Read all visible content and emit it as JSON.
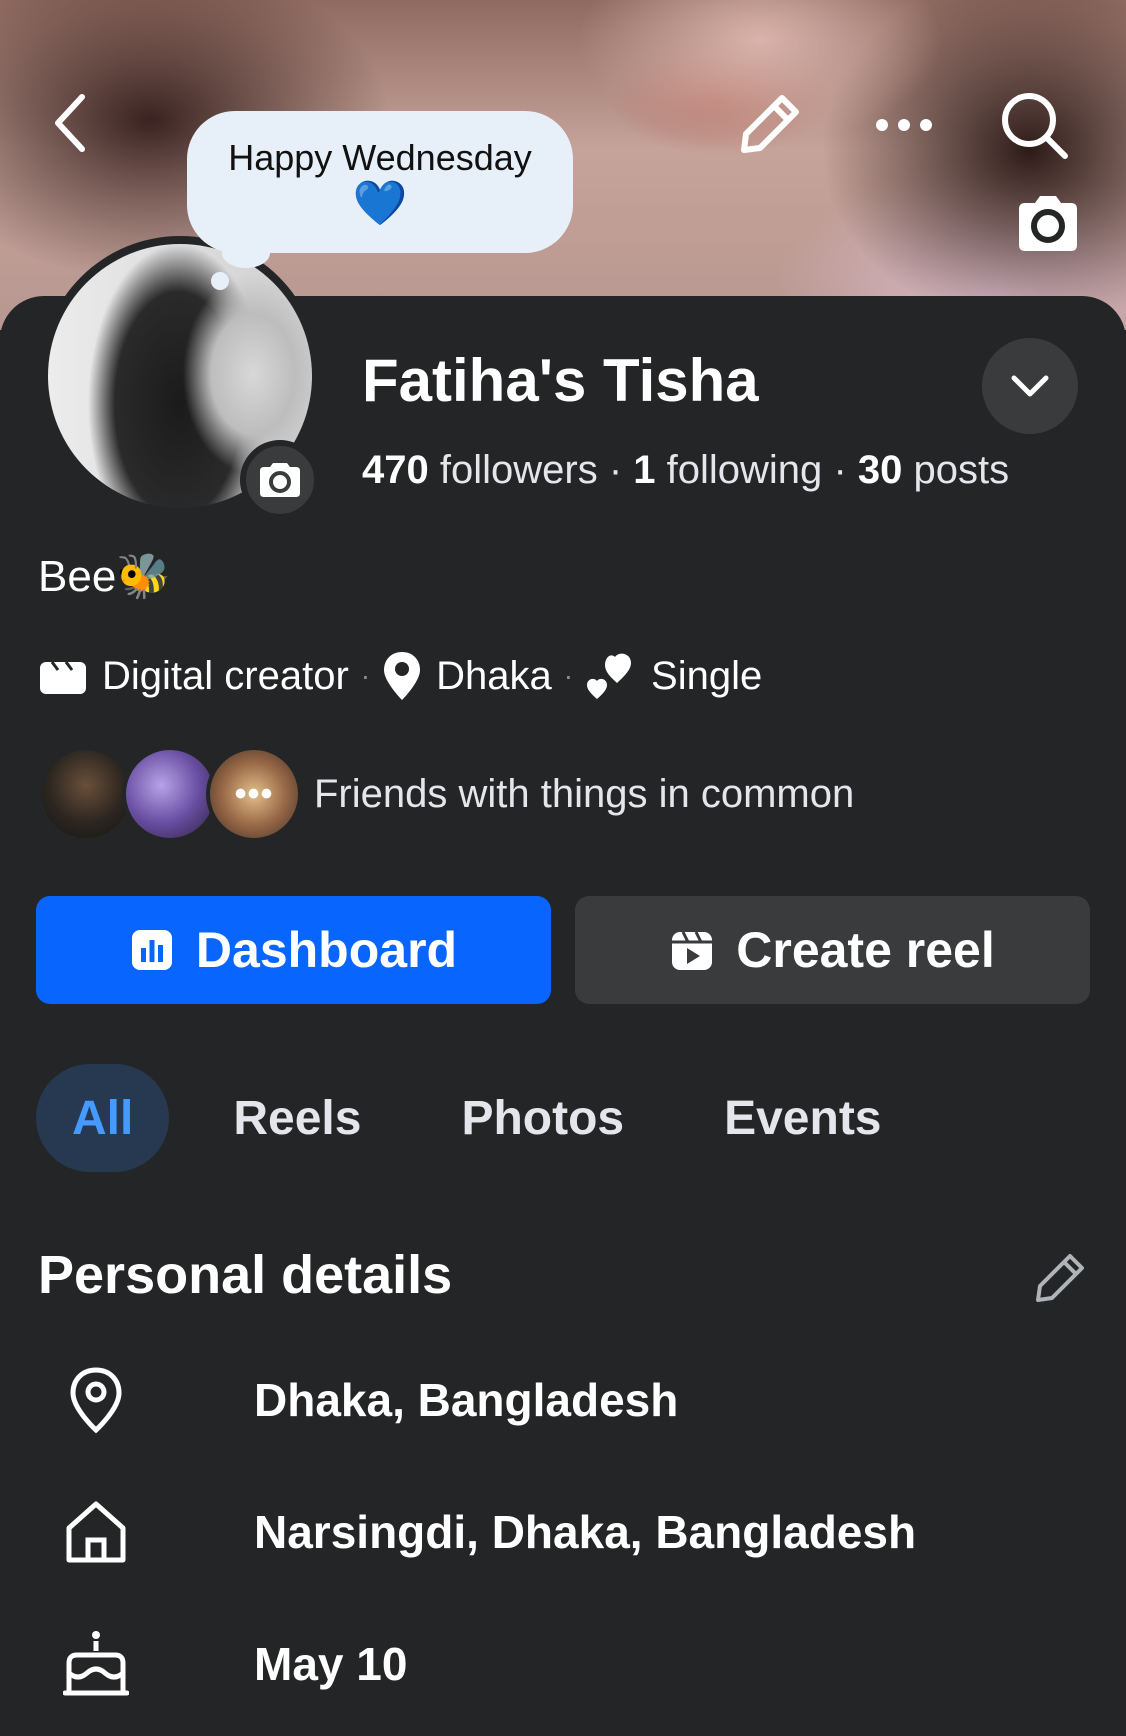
{
  "note": {
    "text": "Happy Wednesday",
    "emoji": "💙"
  },
  "profile": {
    "name": "Fatiha's Tisha",
    "followers_count": "470",
    "followers_label": "followers",
    "following_count": "1",
    "following_label": "following",
    "posts_count": "30",
    "posts_label": "posts",
    "bio": "Bee🐝"
  },
  "meta": {
    "category": "Digital creator",
    "location": "Dhaka",
    "relationship": "Single",
    "separator": "·"
  },
  "friends": {
    "overflow": "•••",
    "text": "Friends with things in common"
  },
  "buttons": {
    "dashboard": "Dashboard",
    "create_reel": "Create reel"
  },
  "tabs": [
    {
      "label": "All",
      "active": true
    },
    {
      "label": "Reels",
      "active": false
    },
    {
      "label": "Photos",
      "active": false
    },
    {
      "label": "Events",
      "active": false
    }
  ],
  "personal_details": {
    "title": "Personal details",
    "items": [
      {
        "icon": "location-pin-icon",
        "text": "Dhaka, Bangladesh"
      },
      {
        "icon": "home-icon",
        "text": "Narsingdi, Dhaka, Bangladesh"
      },
      {
        "icon": "birthday-cake-icon",
        "text": "May 10"
      }
    ]
  },
  "colors": {
    "background": "#242526",
    "primary_button": "#0866ff",
    "secondary_button": "#3a3b3c",
    "active_tab_bg": "#263951",
    "active_tab_text": "#4599ff",
    "note_bubble": "#e7f0f9"
  }
}
